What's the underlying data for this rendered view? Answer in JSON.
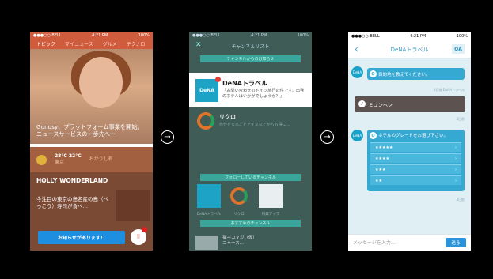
{
  "screen1": {
    "carrier": "●●●○○ BELL",
    "time": "4:21 PM",
    "battery": "100%",
    "tabs": [
      "トピック",
      "マイニュース",
      "グルメ",
      "テクノロ"
    ],
    "headline": "Gunosy、プラットフォーム事業を開始。ニュースサービスの一歩先へ一",
    "weather_temp": "28°C 22°C",
    "weather_city": "東京",
    "weather_extra": "おかりし有",
    "section_title": "HOLLY WONDERLAND",
    "news2": "今注目の東京の島名産の島（べっこう）寿司が食べ…",
    "banner": "お知らせがあります！"
  },
  "screen2": {
    "carrier": "●●●○○ BELL",
    "time": "4:21 PM",
    "battery": "100%",
    "nav_title": "チャンネルリスト",
    "section_top": "チャンネルからのお知らせ",
    "card_title": "DeNAトラベル",
    "card_desc": "「お問い合わせのドイツ旅行の件です。出発のホテルはいかがでしょうか？」",
    "logo_text": "DeNA",
    "rikuro": "リクロ",
    "rikuro_desc": "自分をまるごとアイ又などからお得に…",
    "section_follow": "フォローしているチャンネル",
    "section_more": "おすすめのチャンネル",
    "tiles": [
      "DeNAトラベル",
      "リクロ",
      "特典アップ"
    ],
    "item_title": "猫ネコマガ（仮）",
    "item_desc": "ニャース..."
  },
  "screen3": {
    "carrier": "●●●○○ BELL",
    "time": "4:21 PM",
    "battery": "100%",
    "nav_title": "DeNAトラベル",
    "qa_label": "QA",
    "q1": "目的地を教えてください。",
    "q1_meta": "4日前 DeNAトラベル",
    "answer": "ミュンヘン",
    "answer_meta": "3日前",
    "q2": "ホテルのグレードをお選び下さい。",
    "options": [
      "★★★★★",
      "★★★★",
      "★★★",
      "★★"
    ],
    "q2_meta": "3日前",
    "input_placeholder": "メッセージを入力…",
    "send_label": "送る"
  },
  "arrows": [
    "→",
    "→"
  ]
}
